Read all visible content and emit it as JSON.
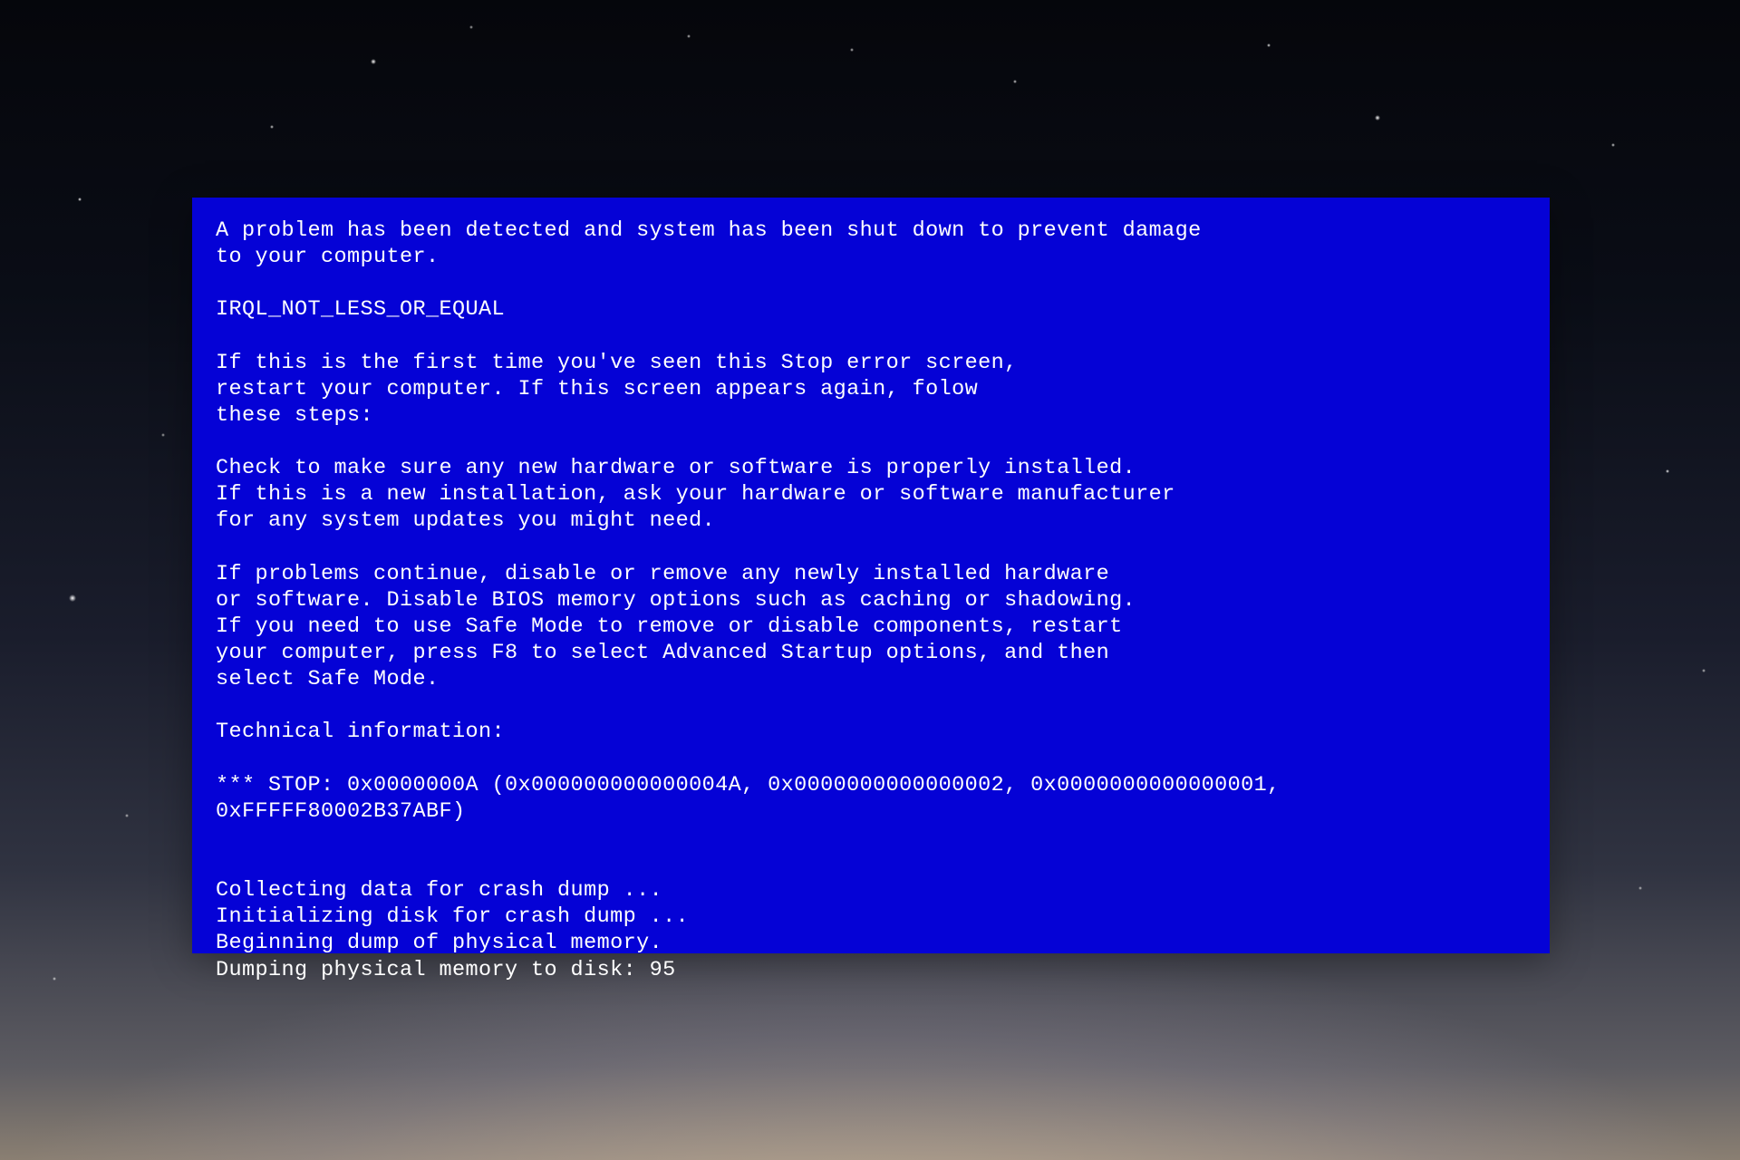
{
  "bsod": {
    "header_line": "A problem has been detected and system has been shut down to prevent damage\nto your computer.",
    "error_name": "IRQL_NOT_LESS_OR_EQUAL",
    "first_time": "If this is the first time you've seen this Stop error screen,\nrestart your computer. If this screen appears again, folow\nthese steps:",
    "check_hardware": "Check to make sure any new hardware or software is properly installed.\nIf this is a new installation, ask your hardware or software manufacturer\nfor any system updates you might need.",
    "problems_continue": "If problems continue, disable or remove any newly installed hardware\nor software. Disable BIOS memory options such as caching or shadowing.\nIf you need to use Safe Mode to remove or disable components, restart\nyour computer, press F8 to select Advanced Startup options, and then\nselect Safe Mode.",
    "technical_label": "Technical information:",
    "stop_line": "*** STOP: 0x0000000A (0x000000000000004A, 0x0000000000000002, 0x0000000000000001,\n0xFFFFF80002B37ABF)",
    "dump_collecting": "Collecting data for crash dump ...",
    "dump_initializing": "Initializing disk for crash dump ...",
    "dump_beginning": "Beginning dump of physical memory.",
    "dump_progress_prefix": "Dumping physical memory to disk: ",
    "dump_progress_value": "95"
  },
  "colors": {
    "bsod_bg": "#0502d6",
    "bsod_fg": "#ffffff"
  }
}
